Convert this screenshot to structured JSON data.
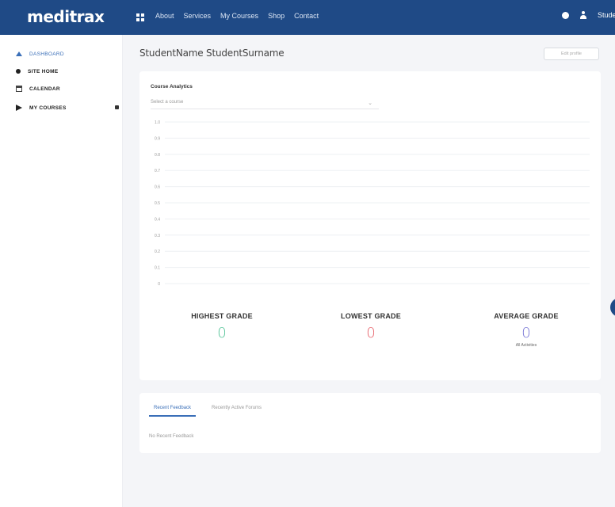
{
  "brand": {
    "logo_text": "meditrax",
    "colors": {
      "navbar": "#1f4a86",
      "accent": "#3a6fb8",
      "highest": "#59c59b",
      "lowest": "#e8676f",
      "average": "#7b79d6"
    }
  },
  "nav": {
    "menu_icon": "grid-icon",
    "links": [
      "About",
      "Services",
      "My Courses",
      "Shop",
      "Contact"
    ]
  },
  "user": {
    "name": "Stude",
    "icons": [
      "bell-icon",
      "user-icon"
    ]
  },
  "sidebar": {
    "items": [
      {
        "label": "DASHBOARD",
        "icon": "home-icon",
        "active": true
      },
      {
        "label": "SITE HOME",
        "icon": "dot-icon",
        "active": false
      },
      {
        "label": "CALENDAR",
        "icon": "calendar-icon",
        "active": false
      },
      {
        "label": "MY COURSES",
        "icon": "graduation-cap-icon",
        "active": false
      }
    ]
  },
  "main": {
    "title": "StudentName StudentSurname",
    "title_button": "Edit profile",
    "analytics": {
      "heading": "Course Analytics",
      "select_placeholder": "Select a course",
      "select_chevron": "⌄"
    },
    "grades": {
      "highest": {
        "label": "HIGHEST GRADE",
        "value": "0"
      },
      "lowest": {
        "label": "LOWEST GRADE",
        "value": "0"
      },
      "average": {
        "label": "AVERAGE GRADE",
        "value": "0",
        "note": "All Activities"
      }
    },
    "feedback": {
      "tabs": [
        "Recent Feedback",
        "Recently Active Forums"
      ],
      "active_tab": 0,
      "empty_text": "No Recent Feedback"
    }
  },
  "chart_data": {
    "type": "line",
    "title": "",
    "xlabel": "",
    "ylabel": "",
    "y_ticks": [
      "0",
      "0.1",
      "0.2",
      "0.3",
      "0.4",
      "0.5",
      "0.6",
      "0.7",
      "0.8",
      "0.9",
      "1.0"
    ],
    "ylim": [
      0,
      1
    ],
    "grid": true,
    "series": []
  }
}
